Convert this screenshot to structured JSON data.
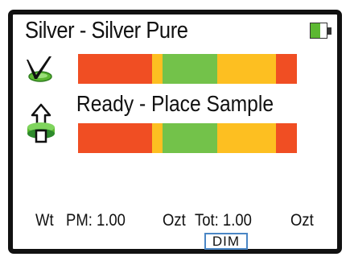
{
  "screen": {
    "title": "Silver - Silver Pure",
    "status_message": "Ready - Place Sample"
  },
  "battery": {
    "level": 0.5,
    "fill_color": "#5cb832"
  },
  "bars": {
    "colors": {
      "red": "#f04e23",
      "yellow": "#fdbf21",
      "green": "#73c24a"
    },
    "top": [
      "red",
      "yellow",
      "green",
      "yellow",
      "red"
    ],
    "bottom": [
      "red",
      "yellow",
      "green",
      "yellow",
      "red"
    ]
  },
  "icons": {
    "check": "check-mark-icon",
    "flip": "flip-sample-icon",
    "battery": "battery-icon"
  },
  "footer": {
    "weight_label": "Wt",
    "pm_label": "PM: 1.00",
    "pm_unit": "Ozt",
    "total_label": "Tot: 1.00",
    "total_unit": "Ozt",
    "dim_button": "DIM"
  }
}
